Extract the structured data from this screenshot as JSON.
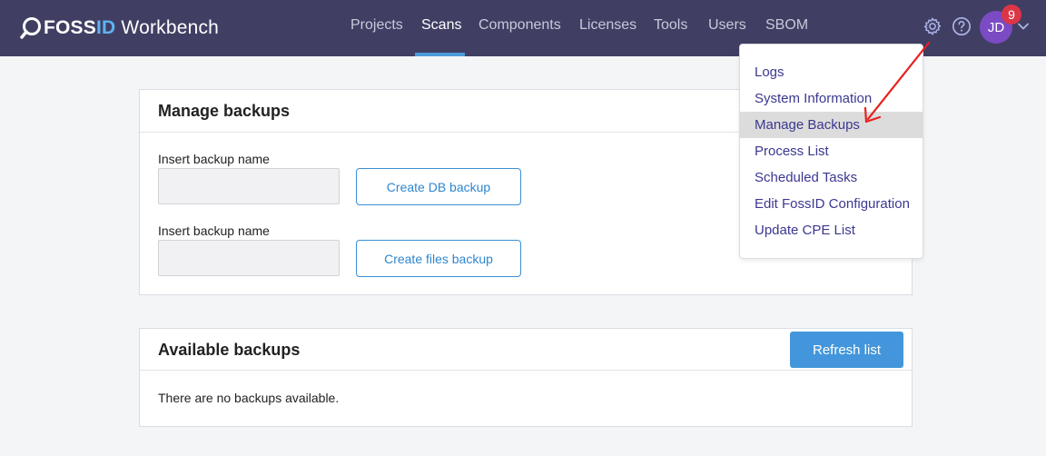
{
  "brand": {
    "part1": "FOSS",
    "part2": "ID",
    "part3": " Workbench"
  },
  "nav": {
    "items": [
      {
        "label": "Projects"
      },
      {
        "label": "Scans"
      },
      {
        "label": "Components"
      },
      {
        "label": "Licenses"
      },
      {
        "label": "Tools"
      },
      {
        "label": "Users"
      },
      {
        "label": "SBOM"
      }
    ],
    "active": "Scans"
  },
  "header": {
    "icons": [
      "gear-icon",
      "help-icon"
    ],
    "avatar_initials": "JD",
    "notification_count": "9"
  },
  "manage_backups": {
    "title": "Manage backups",
    "db_backup": {
      "label": "Insert backup name",
      "value": "",
      "button": "Create DB backup"
    },
    "files_backup": {
      "label": "Insert backup name",
      "value": "",
      "button": "Create files backup"
    }
  },
  "available_backups": {
    "title": "Available backups",
    "refresh_button": "Refresh list",
    "empty_message": "There are no backups available."
  },
  "settings_menu": {
    "items": [
      {
        "label": "Logs"
      },
      {
        "label": "System Information"
      },
      {
        "label": "Manage Backups"
      },
      {
        "label": "Process List"
      },
      {
        "label": "Scheduled Tasks"
      },
      {
        "label": "Edit FossID Configuration"
      },
      {
        "label": "Update CPE List"
      }
    ],
    "highlighted": "Manage Backups"
  },
  "colors": {
    "header_bg": "#403f63",
    "accent": "#4396db",
    "menu_text": "#3b3890",
    "annotation_arrow": "#e8201f",
    "avatar": "#7b4bc4",
    "badge": "#dc3545"
  }
}
